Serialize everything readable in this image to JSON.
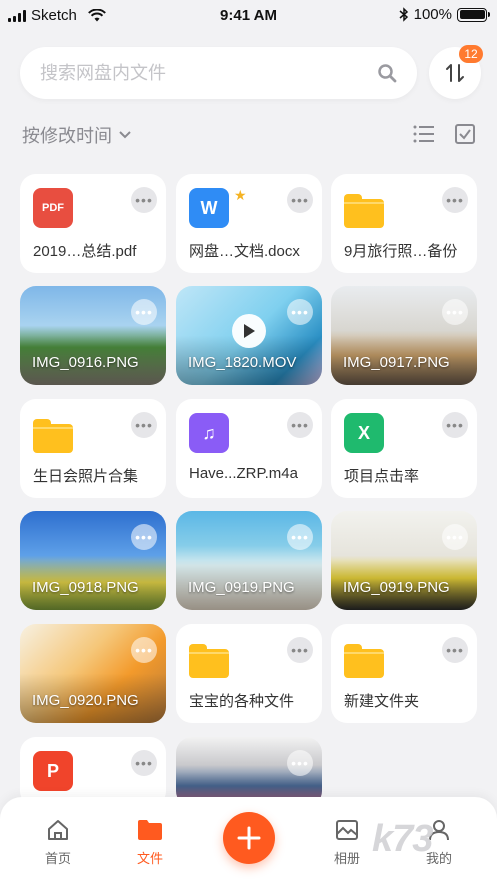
{
  "status_bar": {
    "carrier": "Sketch",
    "time": "9:41 AM",
    "battery": "100%"
  },
  "search": {
    "placeholder": "搜索网盘内文件"
  },
  "sort_badge": "12",
  "filter": {
    "sort_label": "按修改时间"
  },
  "files": [
    {
      "name": "2019…总结.pdf",
      "kind": "pdf",
      "icon_text": "PDF",
      "color": "#e84e40"
    },
    {
      "name": "网盘…文档.docx",
      "kind": "doc",
      "icon_text": "W",
      "color": "#2f8cf5",
      "starred": true
    },
    {
      "name": "9月旅行照…备份",
      "kind": "folder"
    },
    {
      "name": "IMG_0916.PNG",
      "kind": "photo",
      "scene": "street"
    },
    {
      "name": "IMG_1820.MOV",
      "kind": "video",
      "scene": "device"
    },
    {
      "name": "IMG_0917.PNG",
      "kind": "photo",
      "scene": "toast"
    },
    {
      "name": "生日会照片合集",
      "kind": "folder"
    },
    {
      "name": "Have...ZRP.m4a",
      "kind": "audio",
      "icon_text": "♫",
      "color": "#8a5cf6"
    },
    {
      "name": "项目点击率",
      "kind": "sheet",
      "icon_text": "X",
      "color": "#1fba6e"
    },
    {
      "name": "IMG_0918.PNG",
      "kind": "photo",
      "scene": "building"
    },
    {
      "name": "IMG_0919.PNG",
      "kind": "photo",
      "scene": "beach"
    },
    {
      "name": "IMG_0919.PNG",
      "kind": "photo",
      "scene": "toys"
    },
    {
      "name": "IMG_0920.PNG",
      "kind": "photo",
      "scene": "orange"
    },
    {
      "name": "宝宝的各种文件",
      "kind": "folder"
    },
    {
      "name": "新建文件夹",
      "kind": "folder"
    },
    {
      "name": "",
      "kind": "ppt",
      "icon_text": "P",
      "color": "#f0442b"
    },
    {
      "name": "",
      "kind": "photo",
      "scene": "drinks"
    }
  ],
  "tabs": [
    {
      "label": "首页",
      "icon": "home-icon"
    },
    {
      "label": "文件",
      "icon": "folder-icon"
    },
    {
      "label": "相册",
      "icon": "photo-icon"
    },
    {
      "label": "我的",
      "icon": "user-icon"
    }
  ],
  "watermark": "k73"
}
